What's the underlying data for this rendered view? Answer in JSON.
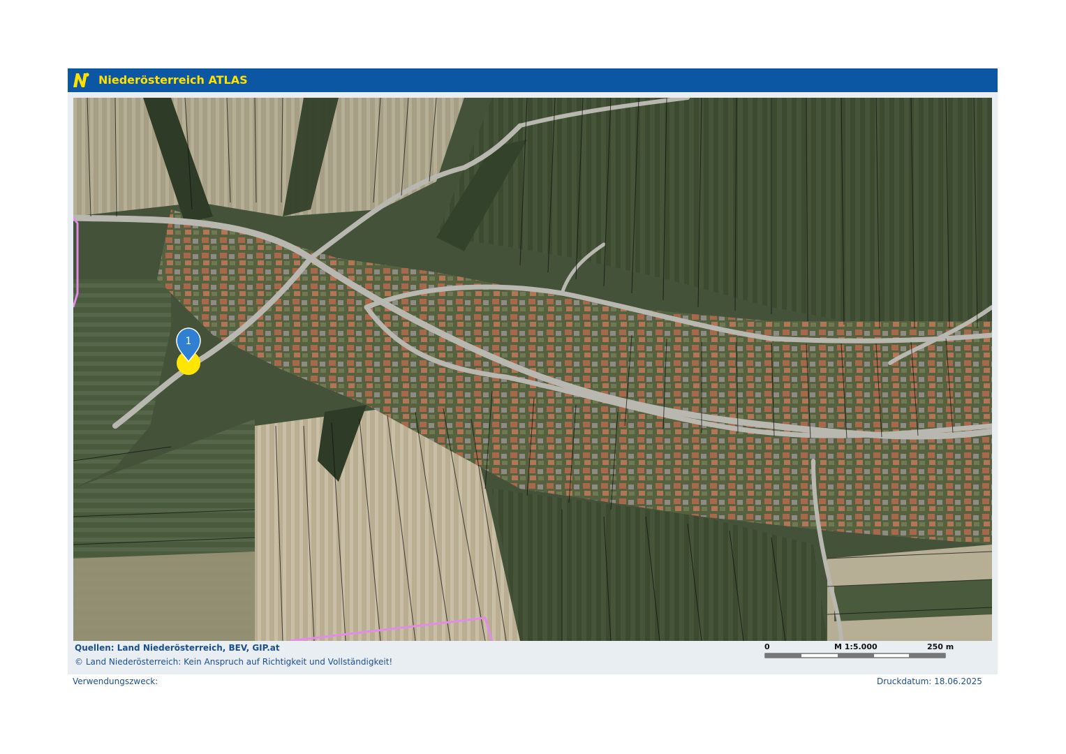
{
  "header": {
    "title": "Niederösterreich ATLAS",
    "logo_icon": "noe-logo-icon",
    "bar_color": "#0b57a4",
    "title_color": "#ffe000"
  },
  "map": {
    "type": "aerial orthophoto with cadastral parcel lines",
    "marker": {
      "label": "1",
      "color": "#2f7fd2",
      "highlight_color": "#ffe600"
    },
    "boundary_color": "#e48be8"
  },
  "footer": {
    "sources": "Quellen: Land Niederösterreich, BEV, GIP.at",
    "copyright": "© Land Niederösterreich: Kein Anspruch auf Richtigkeit und Vollständigkeit!",
    "scale": {
      "start": "0",
      "ratio": "M 1:5.000",
      "end": "250 m"
    },
    "purpose": "Verwendungszweck:",
    "print_date": "Druckdatum: 18.06.2025"
  }
}
